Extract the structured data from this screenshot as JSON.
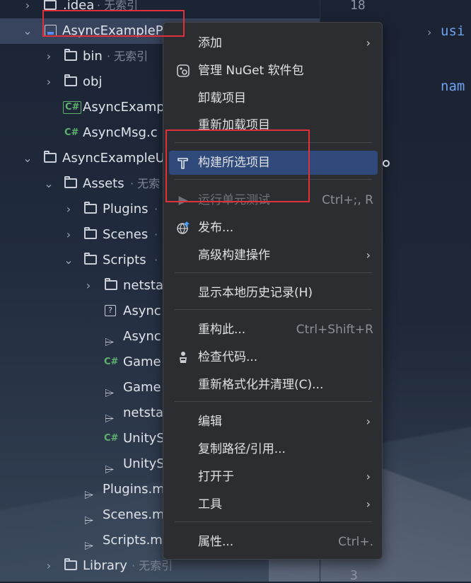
{
  "tree": {
    "rows": [
      {
        "label": ".idea",
        "suffix": "· 无索引"
      },
      {
        "label": "AsyncExampleP",
        "suffix": ""
      },
      {
        "label": "bin",
        "suffix": "· 无索引"
      },
      {
        "label": "obj",
        "suffix": ""
      },
      {
        "label": "AsyncExamp",
        "suffix": "",
        "badge": "C#"
      },
      {
        "label": "AsyncMsg.c",
        "suffix": "",
        "badge": "C#"
      },
      {
        "label": "AsyncExampleU",
        "suffix": ""
      },
      {
        "label": "Assets",
        "suffix": "· 无索"
      },
      {
        "label": "Plugins",
        "suffix": "·"
      },
      {
        "label": "Scenes",
        "suffix": "·"
      },
      {
        "label": "Scripts",
        "suffix": "·"
      },
      {
        "label": "netsta",
        "suffix": ""
      },
      {
        "label": "Async",
        "suffix": "",
        "badge": "?"
      },
      {
        "label": "Async",
        "suffix": ""
      },
      {
        "label": "Game",
        "suffix": "",
        "badge": "C#"
      },
      {
        "label": "Game",
        "suffix": ""
      },
      {
        "label": "netsta",
        "suffix": ""
      },
      {
        "label": "UnityS",
        "suffix": "",
        "badge": "C#"
      },
      {
        "label": "UnityS",
        "suffix": ""
      },
      {
        "label": "Plugins.m",
        "suffix": ""
      },
      {
        "label": "Scenes.m",
        "suffix": ""
      },
      {
        "label": "Scripts.m",
        "suffix": ""
      },
      {
        "label": "Library",
        "suffix": "· 无索引"
      }
    ]
  },
  "editor": {
    "line_top": "18",
    "line_bottom_a": "3",
    "line_bottom_b": "3",
    "code_1": "usi",
    "code_2": "nam"
  },
  "menu": {
    "items": [
      {
        "label": "添加",
        "shortcut": "",
        "submenu": true
      },
      {
        "label": "管理 NuGet 软件包",
        "shortcut": "",
        "icon": "nuget-icon"
      },
      {
        "label": "卸载项目",
        "shortcut": ""
      },
      {
        "label": "重新加载项目",
        "shortcut": ""
      },
      {
        "label": "构建所选项目",
        "shortcut": "",
        "icon": "hammer-icon",
        "active": true
      },
      {
        "label": "运行单元测试",
        "shortcut": "Ctrl+;, R",
        "icon": "run-icon",
        "disabled": true
      },
      {
        "label": "发布...",
        "shortcut": "",
        "icon": "publish-globe-icon"
      },
      {
        "label": "高级构建操作",
        "shortcut": "",
        "submenu": true
      },
      {
        "label": "显示本地历史记录(H)",
        "shortcut": ""
      },
      {
        "label": "重构此...",
        "shortcut": "Ctrl+Shift+R"
      },
      {
        "label": "检查代码...",
        "shortcut": "",
        "icon": "inspector-icon"
      },
      {
        "label": "重新格式化并清理(C)...",
        "shortcut": ""
      },
      {
        "label": "编辑",
        "shortcut": "",
        "submenu": true
      },
      {
        "label": "复制路径/引用...",
        "shortcut": ""
      },
      {
        "label": "打开于",
        "shortcut": "",
        "submenu": true
      },
      {
        "label": "工具",
        "shortcut": "",
        "submenu": true
      },
      {
        "label": "属性...",
        "shortcut": "Ctrl+."
      }
    ]
  },
  "colors": {
    "highlight": "#2f4a7a",
    "annotation_red": "#e0313a",
    "csharp_green": "#5fb26e"
  }
}
